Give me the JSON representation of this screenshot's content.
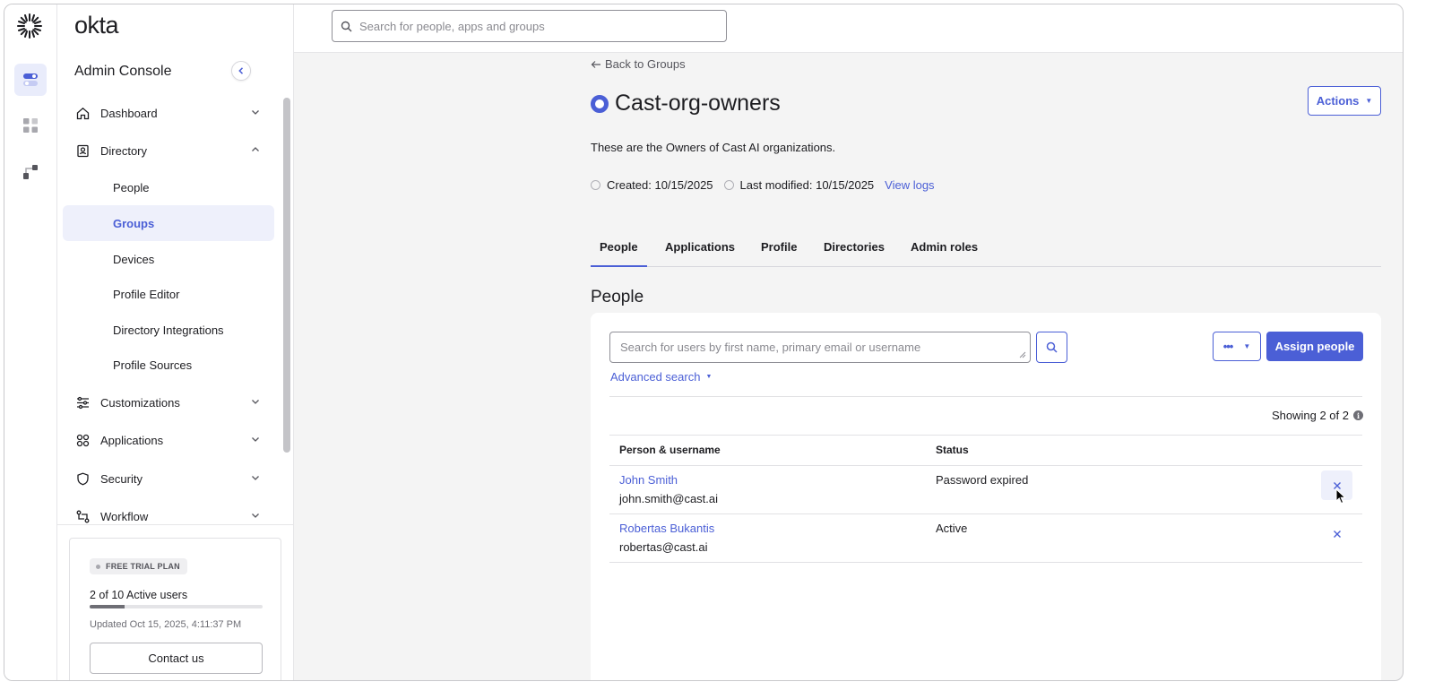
{
  "brand": {
    "name": "okta",
    "console": "Admin Console"
  },
  "rail": [
    {
      "name": "admin-toggle-icon",
      "active": true
    },
    {
      "name": "apps-grid-icon",
      "active": false
    },
    {
      "name": "workflow-icon",
      "active": false
    }
  ],
  "search": {
    "placeholder": "Search for people, apps and groups"
  },
  "sidebar": {
    "items": [
      {
        "label": "Dashboard",
        "icon": "home-icon",
        "expanded": false
      },
      {
        "label": "Directory",
        "icon": "directory-icon",
        "expanded": true
      },
      {
        "label": "Customizations",
        "icon": "sliders-icon",
        "expanded": false
      },
      {
        "label": "Applications",
        "icon": "apps-icon",
        "expanded": false
      },
      {
        "label": "Security",
        "icon": "shield-icon",
        "expanded": false
      },
      {
        "label": "Workflow",
        "icon": "workflow-icon",
        "expanded": false
      }
    ],
    "directory_sub": [
      {
        "label": "People",
        "active": false
      },
      {
        "label": "Groups",
        "active": true
      },
      {
        "label": "Devices",
        "active": false
      },
      {
        "label": "Profile Editor",
        "active": false
      },
      {
        "label": "Directory Integrations",
        "active": false
      },
      {
        "label": "Profile Sources",
        "active": false
      }
    ]
  },
  "trial": {
    "badge": "FREE TRIAL PLAN",
    "users": "2 of 10 Active users",
    "active_fraction": 0.2,
    "updated": "Updated Oct 15, 2025, 4:11:37 PM",
    "contact": "Contact us"
  },
  "group": {
    "back": "Back to Groups",
    "title": "Cast-org-owners",
    "actions": "Actions",
    "description": "These are the Owners of Cast AI organizations.",
    "created": "Created: 10/15/2025",
    "modified": "Last modified: 10/15/2025",
    "view_logs": "View logs"
  },
  "tabs": [
    {
      "label": "People",
      "active": true
    },
    {
      "label": "Applications",
      "active": false
    },
    {
      "label": "Profile",
      "active": false
    },
    {
      "label": "Directories",
      "active": false
    },
    {
      "label": "Admin roles",
      "active": false
    }
  ],
  "people": {
    "section_title": "People",
    "search_placeholder": "Search for users by first name, primary email or username",
    "more_label": "•••",
    "assign": "Assign people",
    "advanced": "Advanced search",
    "showing": "Showing 2 of 2",
    "columns": [
      "Person & username",
      "Status"
    ],
    "rows": [
      {
        "name": "John Smith",
        "email": "john.smith@cast.ai",
        "status": "Password expired"
      },
      {
        "name": "Robertas Bukantis",
        "email": "robertas@cast.ai",
        "status": "Active"
      }
    ]
  },
  "colors": {
    "accent": "#4b5fd6",
    "background": "#f4f4f4"
  }
}
